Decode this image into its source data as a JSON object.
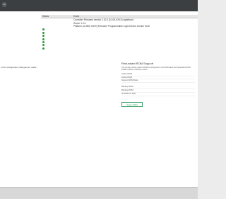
{
  "topbar": {
    "menu_icon": "hamburger-menu-icon"
  },
  "status_table": {
    "headers": [
      "Status",
      "",
      "Event"
    ],
    "rows": [
      {
        "status": "",
        "event": "Controller Firmware version 2.10.0 (10-08-XXXX) significant"
      },
      {
        "status": "",
        "event": "Server 1.3.0"
      },
      {
        "status": "",
        "event": "Platform (XL350) Gen9 (Firmware Programmable Logic Device version 0x1E"
      },
      {
        "status": "ok",
        "event": ""
      },
      {
        "status": "ok",
        "event": ""
      },
      {
        "status": "ok",
        "event": ""
      },
      {
        "status": "ok",
        "event": ""
      },
      {
        "status": "ok",
        "event": ""
      },
      {
        "status": "ok",
        "event": ""
      },
      {
        "status": "ok",
        "event": ""
      }
    ]
  },
  "left_message": "e the configuration changes are made.",
  "left_dot": ".",
  "rom_panel": {
    "title": "Redundant ROM Support",
    "description": "The primary Active system ROM is configured to the ROM bank with redundant ROM. ROM contains a backup version.",
    "active_items": [
      "Active ROM",
      "Active ROM",
      "System ROM Date"
    ],
    "backup_items": [
      "Backup ROM",
      "Backup ROM",
      "Rt ROM Or Date"
    ],
    "swap_button": "Swap ROM"
  },
  "colors": {
    "status_ok": "#2e9b3a",
    "accent": "#3aa36a",
    "topbar": "#3c3f41"
  }
}
